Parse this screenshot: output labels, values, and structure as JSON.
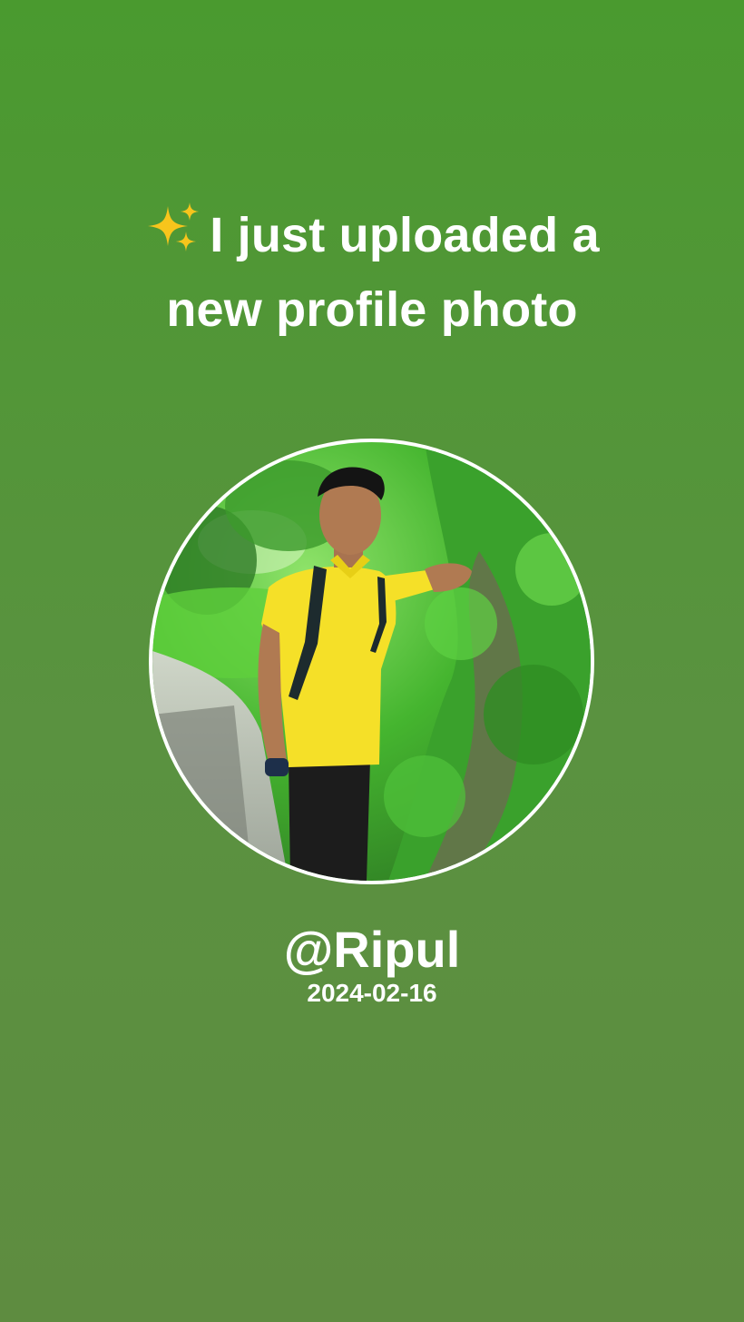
{
  "post": {
    "headline_line1": "I just uploaded a",
    "headline_line2": "new profile photo",
    "headline_icon": "sparkles-icon",
    "username": "@Ripul",
    "date": "2024-02-16"
  },
  "colors": {
    "background_top": "#4a9a2f",
    "background_bottom": "#5e8c40",
    "text": "#ffffff",
    "photo_border": "#ffffff"
  }
}
